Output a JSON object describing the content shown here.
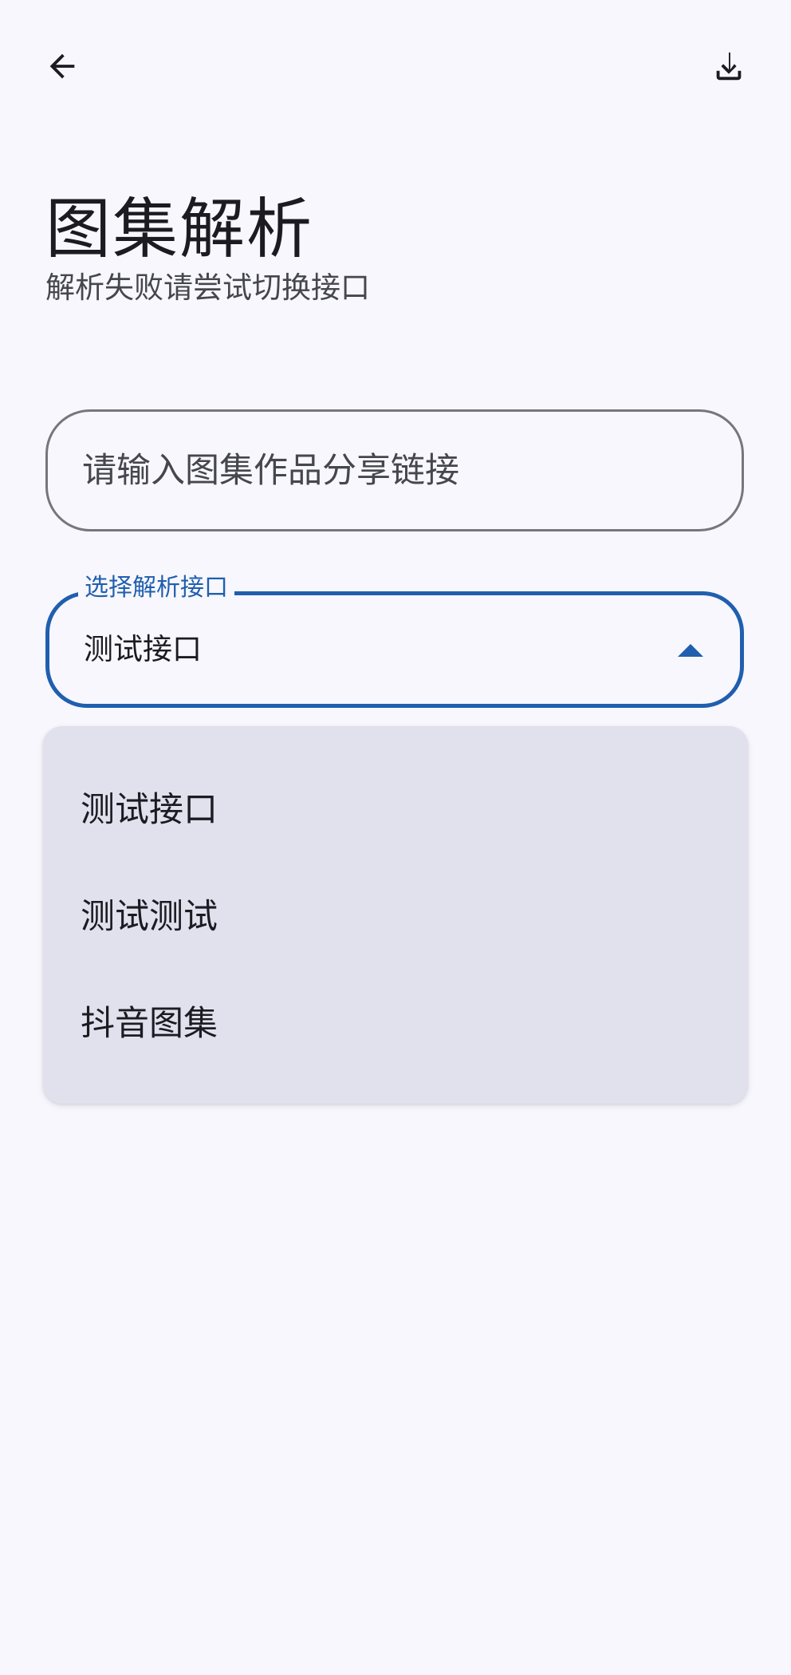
{
  "toolbar": {
    "back_icon": "arrow-back-icon",
    "download_icon": "download-icon"
  },
  "header": {
    "title": "图集解析",
    "subtitle": "解析失败请尝试切换接口"
  },
  "link_input": {
    "placeholder": "请输入图集作品分享链接",
    "value": ""
  },
  "api_select": {
    "label": "选择解析接口",
    "selected": "测试接口",
    "expanded": true,
    "accent_color": "#1f5fae"
  },
  "api_menu": {
    "options": [
      {
        "label": "测试接口"
      },
      {
        "label": "测试测试"
      },
      {
        "label": "抖音图集"
      }
    ]
  },
  "colors": {
    "background": "#f8f7fd",
    "menu_background": "#e1e1ee",
    "outline": "#77767f"
  }
}
